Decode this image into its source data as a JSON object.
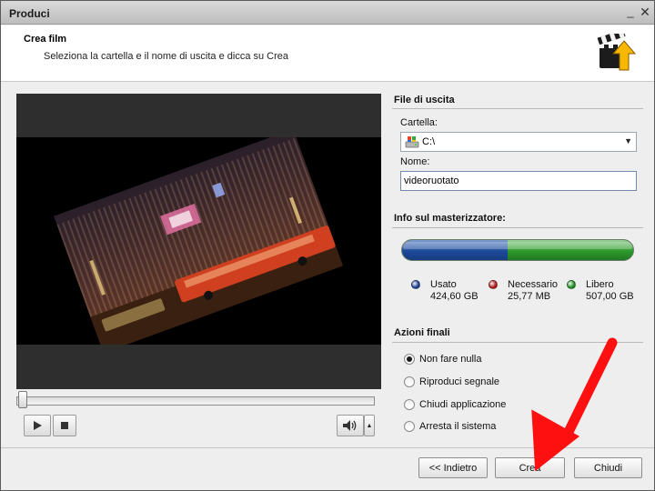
{
  "window": {
    "title": "Produci"
  },
  "header": {
    "title": "Crea film",
    "subtitle": "Seleziona la cartella e il nome di uscita e dicca su Crea",
    "icon": "clapperboard-upload-icon"
  },
  "output": {
    "section_title": "File di uscita",
    "folder_label": "Cartella:",
    "folder_value": "C:\\",
    "name_label": "Nome:",
    "name_value": "videoruotato"
  },
  "burner": {
    "section_title": "Info sul masterizzatore:",
    "used_fraction": 0.456,
    "needed_fraction": 0.0,
    "legend": [
      {
        "name": "Usato",
        "value": "424,60 GB",
        "color": "#1d3f8f"
      },
      {
        "name": "Necessario",
        "value": "25,77 MB",
        "color": "#b01818"
      },
      {
        "name": "Libero",
        "value": "507,00 GB",
        "color": "#1f8a1f"
      }
    ]
  },
  "final_actions": {
    "section_title": "Azioni finali",
    "options": [
      {
        "label": "Non fare nulla",
        "checked": true
      },
      {
        "label": "Riproduci segnale",
        "checked": false
      },
      {
        "label": "Chiudi applicazione",
        "checked": false
      },
      {
        "label": "Arresta il sistema",
        "checked": false
      }
    ]
  },
  "player": {
    "play_icon": "play-icon",
    "stop_icon": "stop-icon",
    "volume_icon": "speaker-icon",
    "seek_fraction": 0.0
  },
  "buttons": {
    "back": "<< Indietro",
    "create": "Crea",
    "close": "Chiudi"
  },
  "colors": {
    "annotation_arrow": "#ff1010"
  }
}
